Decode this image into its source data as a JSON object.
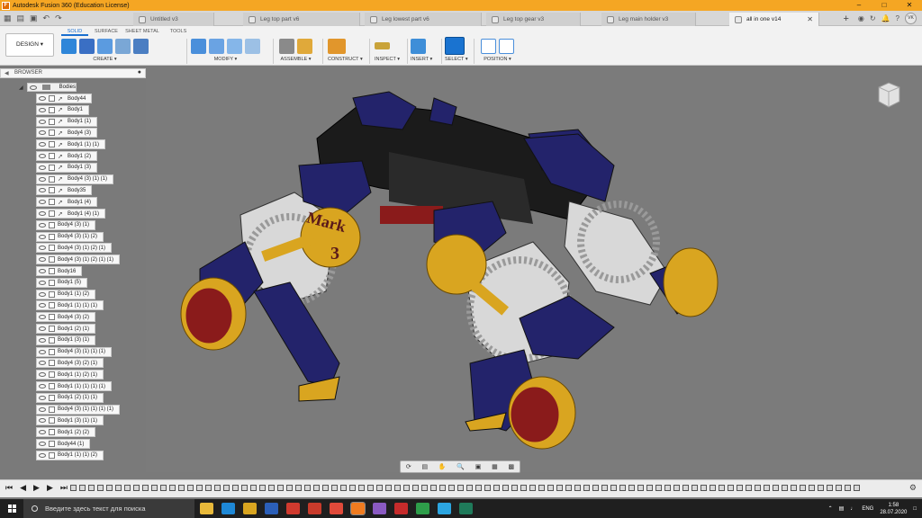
{
  "window": {
    "title": "Autodesk Fusion 360 (Education License)"
  },
  "tabs": [
    {
      "label": "Untitled v3"
    },
    {
      "label": "Leg top part v6"
    },
    {
      "label": "Leg lowest part v6"
    },
    {
      "label": "Leg top gear v3"
    },
    {
      "label": "Leg main holder v3"
    },
    {
      "label": "all in one v14",
      "active": true
    }
  ],
  "user": {
    "initials": "VK"
  },
  "toolbar": {
    "workspace": "DESIGN ▾",
    "subtabs": [
      "SOLID",
      "SURFACE",
      "SHEET METAL",
      "TOOLS"
    ],
    "groups": [
      "CREATE ▾",
      "MODIFY ▾",
      "ASSEMBLE ▾",
      "CONSTRUCT ▾",
      "INSPECT ▾",
      "INSERT ▾",
      "SELECT ▾",
      "POSITION ▾"
    ]
  },
  "browser": {
    "title": "BROWSER",
    "folder": "Bodies",
    "items": [
      "Body44",
      "Body1",
      "Body1 (1)",
      "Body4 (3)",
      "Body1 (1) (1)",
      "Body1 (2)",
      "Body1 (3)",
      "Body4 (3) (1) (1)",
      "Body35",
      "Body1 (4)",
      "Body1 (4) (1)",
      "Body4 (3) (1)",
      "Body4 (3) (1) (2)",
      "Body4 (3) (1) (2) (1)",
      "Body4 (3) (1) (2) (1) (1)",
      "Body16",
      "Body1 (5)",
      "Body1 (1) (2)",
      "Body1 (1) (1) (1)",
      "Body4 (3) (2)",
      "Body1 (2) (1)",
      "Body1 (3) (1)",
      "Body4 (3) (1) (1) (1)",
      "Body4 (3) (2) (1)",
      "Body1 (1) (2) (1)",
      "Body1 (1) (1) (1) (1)",
      "Body1 (2) (1) (1)",
      "Body4 (3) (1) (1) (1) (1)",
      "Body1 (3) (1) (1)",
      "Body1 (2) (2)",
      "Body44 (1)",
      "Body1 (1) (1) (2)"
    ]
  },
  "model": {
    "label_line1": "Mark",
    "label_line2": "3"
  },
  "taskbar": {
    "search_placeholder": "Введите здесь текст для поиска",
    "language": "ENG",
    "time": "1:58",
    "date": "28.07.2020"
  },
  "colors": {
    "navy": "#23236b",
    "gold": "#d9a520",
    "gray_panel": "#d8d8d8",
    "body_black": "#1b1b1b"
  }
}
